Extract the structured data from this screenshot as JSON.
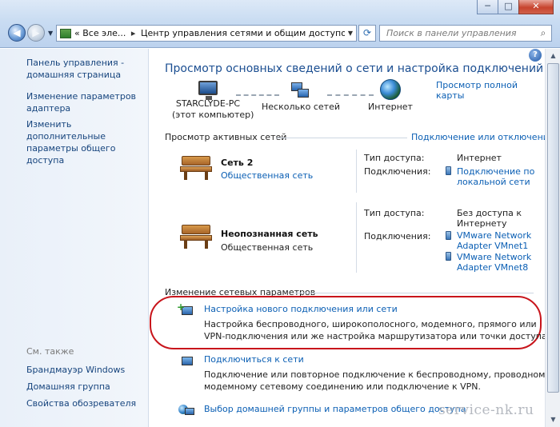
{
  "window": {
    "minimize_icon": "minimize-icon",
    "maximize_icon": "maximize-icon",
    "close_icon": "close-icon",
    "min_glyph": "─",
    "max_glyph": "□",
    "close_glyph": "✕"
  },
  "nav": {
    "back_glyph": "◀",
    "forward_glyph": "▶",
    "dropdown_glyph": "▼"
  },
  "address": {
    "prefix": "«",
    "segment1": "Все элe...",
    "separator": "▸",
    "segment2": "Центр управления сетями и общим доступом",
    "dropdown_glyph": "▼",
    "refresh_glyph": "⟳"
  },
  "search": {
    "placeholder": "Поиск в панели управления",
    "icon_glyph": "⌕"
  },
  "sidebar": {
    "items": [
      {
        "label": "Панель управления - домашняя страница"
      },
      {
        "label": "Изменение параметров адаптера"
      },
      {
        "label": "Изменить дополнительные параметры общего доступа"
      }
    ],
    "see_also_label": "См. также",
    "see_also": [
      {
        "label": "Брандмауэр Windows"
      },
      {
        "label": "Домашняя группа"
      },
      {
        "label": "Свойства обозревателя"
      }
    ]
  },
  "main": {
    "help_glyph": "?",
    "title": "Просмотр основных сведений о сети и настройка подключений",
    "full_map_link": "Просмотр полной карты",
    "map": {
      "computer_name": "STARCLYDE-PC",
      "computer_sub": "(этот компьютер)",
      "networks_label": "Несколько сетей",
      "internet_label": "Интернет"
    },
    "active_networks": {
      "heading": "Просмотр активных сетей",
      "connect_link": "Подключение или отключение",
      "networks": [
        {
          "name": "Сеть  2",
          "type": "Общественная сеть",
          "access_label": "Тип доступа:",
          "access_value": "Интернет",
          "connections_label": "Подключения:",
          "connections": [
            "Подключение по",
            "локальной сети"
          ]
        },
        {
          "name": "Неопознанная сеть",
          "type": "Общественная сеть",
          "access_label": "Тип доступа:",
          "access_value": [
            "Без доступа к",
            "Интернету"
          ],
          "connections_label": "Подключения:",
          "connections": [
            "VMware Network",
            "Adapter VMnet1",
            "VMware Network",
            "Adapter VMnet8"
          ]
        }
      ]
    },
    "change_settings": {
      "heading": "Изменение сетевых параметров",
      "tasks": [
        {
          "title": "Настройка нового подключения или сети",
          "desc": [
            "Настройка беспроводного, широкополосного, модемного, прямого или",
            "VPN-подключения или же настройка маршрутизатора или точки доступа."
          ]
        },
        {
          "title": "Подключиться к сети",
          "desc": [
            "Подключение или повторное подключение к беспроводному, проводному,",
            "модемному сетевому соединению или подключение к VPN."
          ]
        },
        {
          "title": "Выбор домашней группы и параметров общего доступа",
          "desc": []
        }
      ]
    }
  },
  "scrollbar": {
    "up_glyph": "▲",
    "down_glyph": "▼"
  },
  "watermark": "service-nk.ru",
  "colors": {
    "link": "#0b5fb4",
    "title": "#1b4e91",
    "highlight": "#c8141b"
  }
}
